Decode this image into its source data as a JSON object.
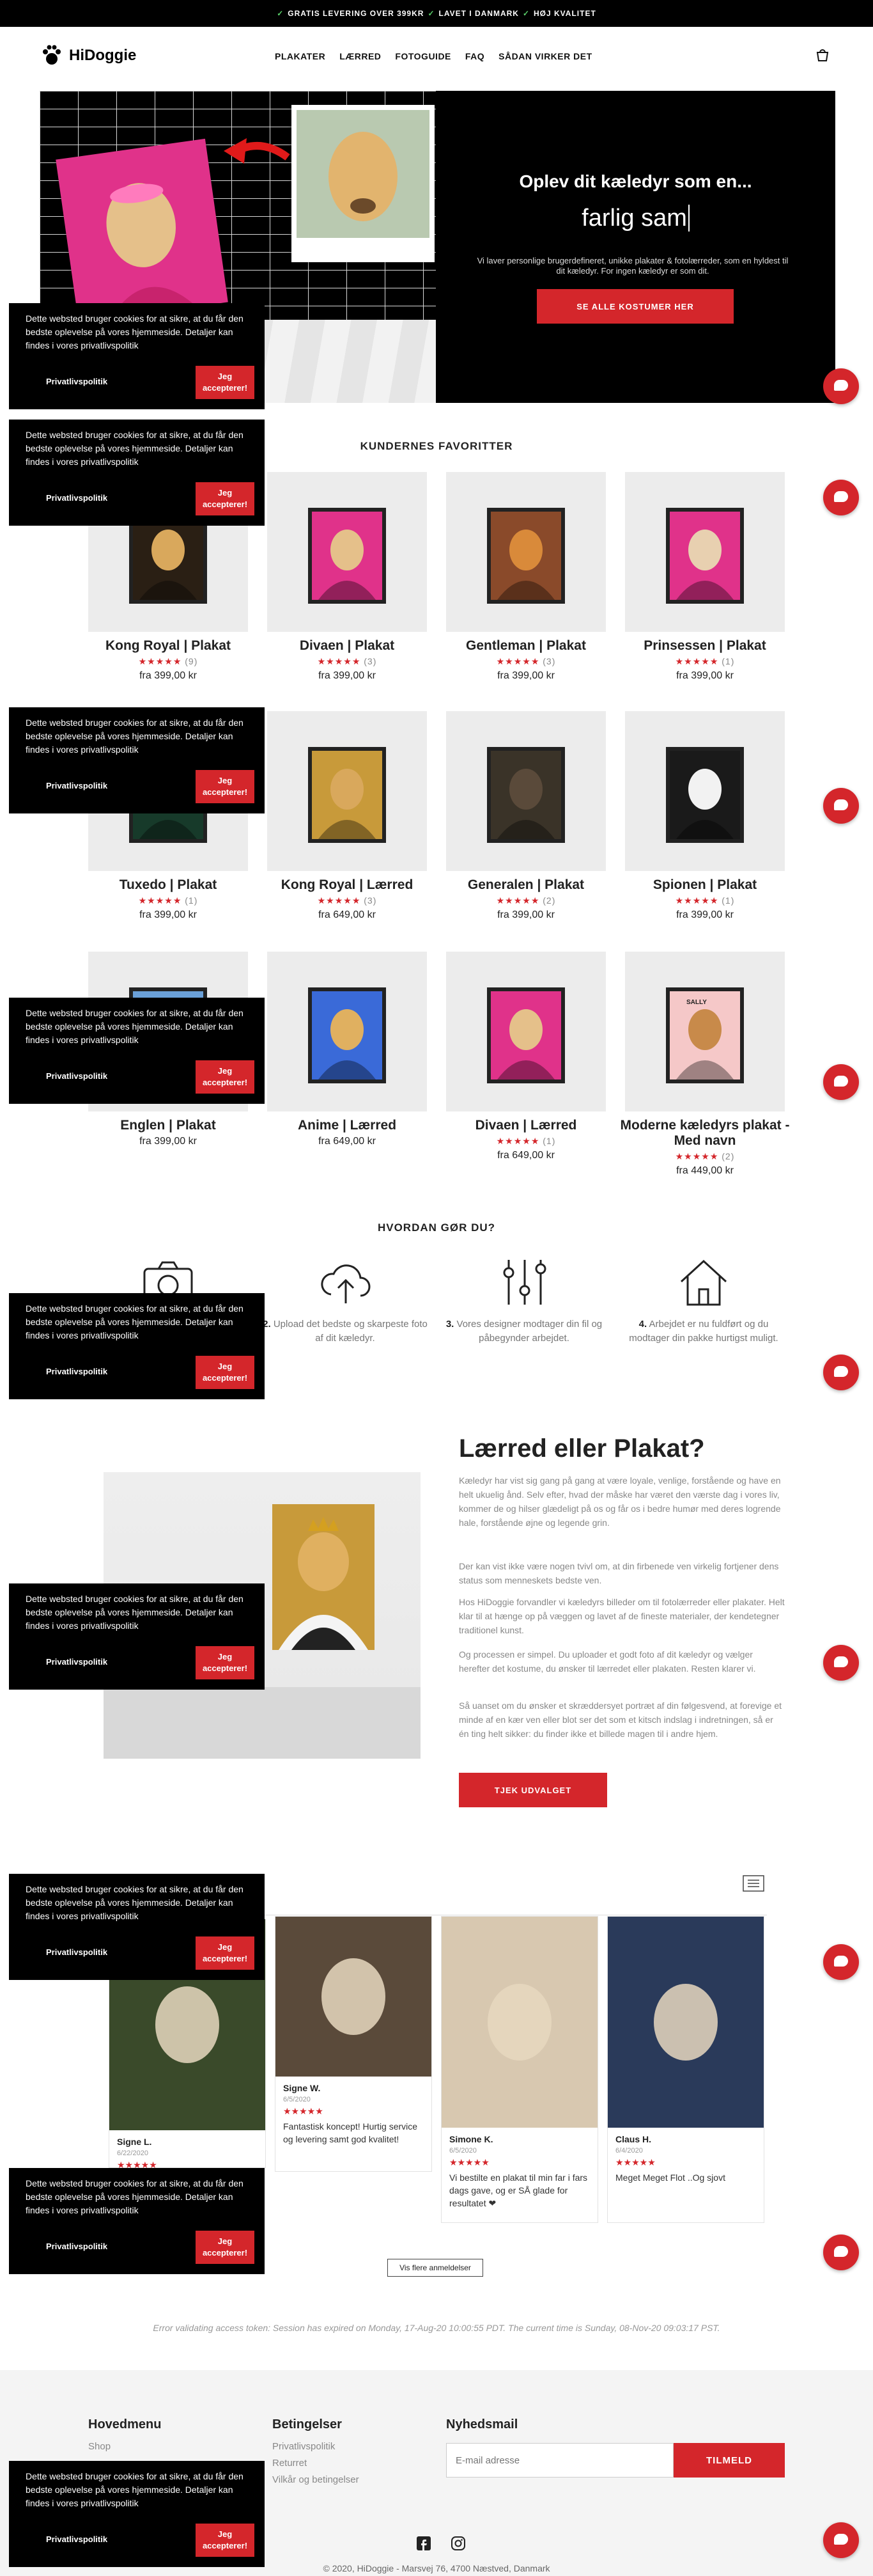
{
  "topbar": {
    "items": [
      "GRATIS LEVERING OVER 399KR",
      "LAVET I DANMARK",
      "HØJ KVALITET"
    ]
  },
  "header": {
    "logo": "HiDoggie",
    "nav": [
      "PLAKATER",
      "LÆRRED",
      "FOTOGUIDE",
      "FAQ",
      "SÅDAN VIRKER DET"
    ]
  },
  "hero": {
    "title": "Oplev dit kæledyr som en...",
    "typed": "farlig sam",
    "text": "Vi laver personlige brugerdefineret, unikke plakater & fotolærreder, som en hyldest til dit kæledyr. For ingen kæledyr er som dit.",
    "button": "SE ALLE KOSTUMER HER"
  },
  "favorites": {
    "title": "KUNDERNES FAVORITTER",
    "products": [
      {
        "name": "Kong Royal | Plakat",
        "stars": "★★★★★",
        "count": "(9)",
        "price": "fra 399,00 kr",
        "bg": "#2a1f14",
        "face": "#d9a85c"
      },
      {
        "name": "Divaen | Plakat",
        "stars": "★★★★★",
        "count": "(3)",
        "price": "fra 399,00 kr",
        "bg": "#e0328a",
        "face": "#e5c08a"
      },
      {
        "name": "Gentleman | Plakat",
        "stars": "★★★★★",
        "count": "(3)",
        "price": "fra 399,00 kr",
        "bg": "#8a4a2a",
        "face": "#d98a3a"
      },
      {
        "name": "Prinsessen | Plakat",
        "stars": "★★★★★",
        "count": "(1)",
        "price": "fra 399,00 kr",
        "bg": "#e0328a",
        "face": "#e8d0b0"
      },
      {
        "name": "Tuxedo | Plakat",
        "stars": "★★★★★",
        "count": "(1)",
        "price": "fra 399,00 kr",
        "bg": "#173a2a",
        "face": "#3a3a3a"
      },
      {
        "name": "Kong Royal | Lærred",
        "stars": "★★★★★",
        "count": "(3)",
        "price": "fra 649,00 kr",
        "bg": "#c89a3a",
        "face": "#d9a85c"
      },
      {
        "name": "Generalen | Plakat",
        "stars": "★★★★★",
        "count": "(2)",
        "price": "fra 399,00 kr",
        "bg": "#3a3328",
        "face": "#5a4a3a"
      },
      {
        "name": "Spionen | Plakat",
        "stars": "★★★★★",
        "count": "(1)",
        "price": "fra 399,00 kr",
        "bg": "#1a1a1a",
        "face": "#f2f2f2"
      },
      {
        "name": "Englen | Plakat",
        "stars": "",
        "count": "",
        "price": "fra 399,00 kr",
        "bg": "#6aa0d8",
        "face": "#e8e0d0"
      },
      {
        "name": "Anime | Lærred",
        "stars": "",
        "count": "",
        "price": "fra 649,00 kr",
        "bg": "#3a6ad8",
        "face": "#e0b060"
      },
      {
        "name": "Divaen | Lærred",
        "stars": "★★★★★",
        "count": "(1)",
        "price": "fra 649,00 kr",
        "bg": "#e0328a",
        "face": "#e5c08a"
      },
      {
        "name": "Moderne kæledyrs plakat - Med navn",
        "stars": "★★★★★",
        "count": "(2)",
        "price": "fra 449,00 kr",
        "bg": "#f5c8c8",
        "face": "#c88a4a",
        "tag": "SALLY"
      }
    ]
  },
  "steps": {
    "title": "HVORDAN GØR DU?",
    "items": [
      {
        "num": "1.",
        "text": ""
      },
      {
        "num": "2.",
        "text": "Upload det bedste og skarpeste foto af dit kæledyr."
      },
      {
        "num": "3.",
        "text": "Vores designer modtager din fil og påbegynder arbejdet."
      },
      {
        "num": "4.",
        "text": "Arbejdet er nu fuldført og du modtager din pakke hurtigst muligt."
      }
    ]
  },
  "lp": {
    "title": "Lærred eller Plakat?",
    "paras": [
      "Kæledyr har vist sig gang på gang at være loyale, venlige, forstående og have en helt ukuelig ånd. Selv efter, hvad der måske har været den værste dag i vores liv, kommer de og hilser glædeligt på os og får os i bedre humør med deres logrende hale, forstående øjne og legende grin.",
      "Der kan vist ikke være nogen tvivl om, at din firbenede ven virkelig fortjener dens status som menneskets bedste ven.",
      "Hos HiDoggie forvandler vi kæledyrs billeder om til fotolærreder eller plakater. Helt klar til at hænge op på væggen og lavet af de fineste materialer, der kendetegner traditionel kunst.",
      "Og processen er simpel. Du uploader et godt foto af dit kæledyr og vælger herefter det kostume, du ønsker til lærredet eller plakaten. Resten klarer vi.",
      "Så uanset om du ønsker et skræddersyet portræt af din følgesvend, at forevige et minde af en kær ven eller blot ser det som et kitsch indslag i indretningen, så er én ting helt sikker: du finder ikke et billede magen til i andre hjem."
    ],
    "button": "TJEK UDVALGET"
  },
  "reviews": {
    "items": [
      {
        "name": "Signe L.",
        "date": "6/22/2020",
        "stars": "★★★★★",
        "text": ""
      },
      {
        "name": "Signe W.",
        "date": "6/5/2020",
        "stars": "★★★★★",
        "text": "Fantastisk koncept! Hurtig service og levering samt god kvalitet!"
      },
      {
        "name": "Simone K.",
        "date": "6/5/2020",
        "stars": "★★★★★",
        "text": "Vi bestilte en plakat til min far i fars dags gave, og er SÅ glade for resultatet ❤"
      },
      {
        "name": "Claus H.",
        "date": "6/4/2020",
        "stars": "★★★★★",
        "text": "Meget Meget Flot ..Og sjovt"
      }
    ],
    "more": "Vis flere anmeldelser"
  },
  "error": "Error validating access token: Session has expired on Monday, 17-Aug-20 10:00:55 PDT. The current time is Sunday, 08-Nov-20 09:03:17 PST.",
  "footer": {
    "menu_title": "Hovedmenu",
    "menu": [
      "Shop"
    ],
    "terms_title": "Betingelser",
    "terms": [
      "Privatlivspolitik",
      "Returret",
      "Vilkår og betingelser"
    ],
    "news_title": "Nyhedsmail",
    "email_placeholder": "E-mail adresse",
    "signup": "TILMELD",
    "copyright": "© 2020, HiDoggie - Marsvej 76, 4700 Næstved, Danmark"
  },
  "cookie": {
    "text": "Dette websted bruger cookies for at sikre, at du får den bedste oplevelse på vores hjemmeside. Detaljer kan findes i vores privatlivspolitik",
    "policy": "Privatlivspolitik",
    "accept": "Jeg accepterer!"
  },
  "colors": {
    "accent": "#d4262b",
    "dark": "#000000"
  }
}
